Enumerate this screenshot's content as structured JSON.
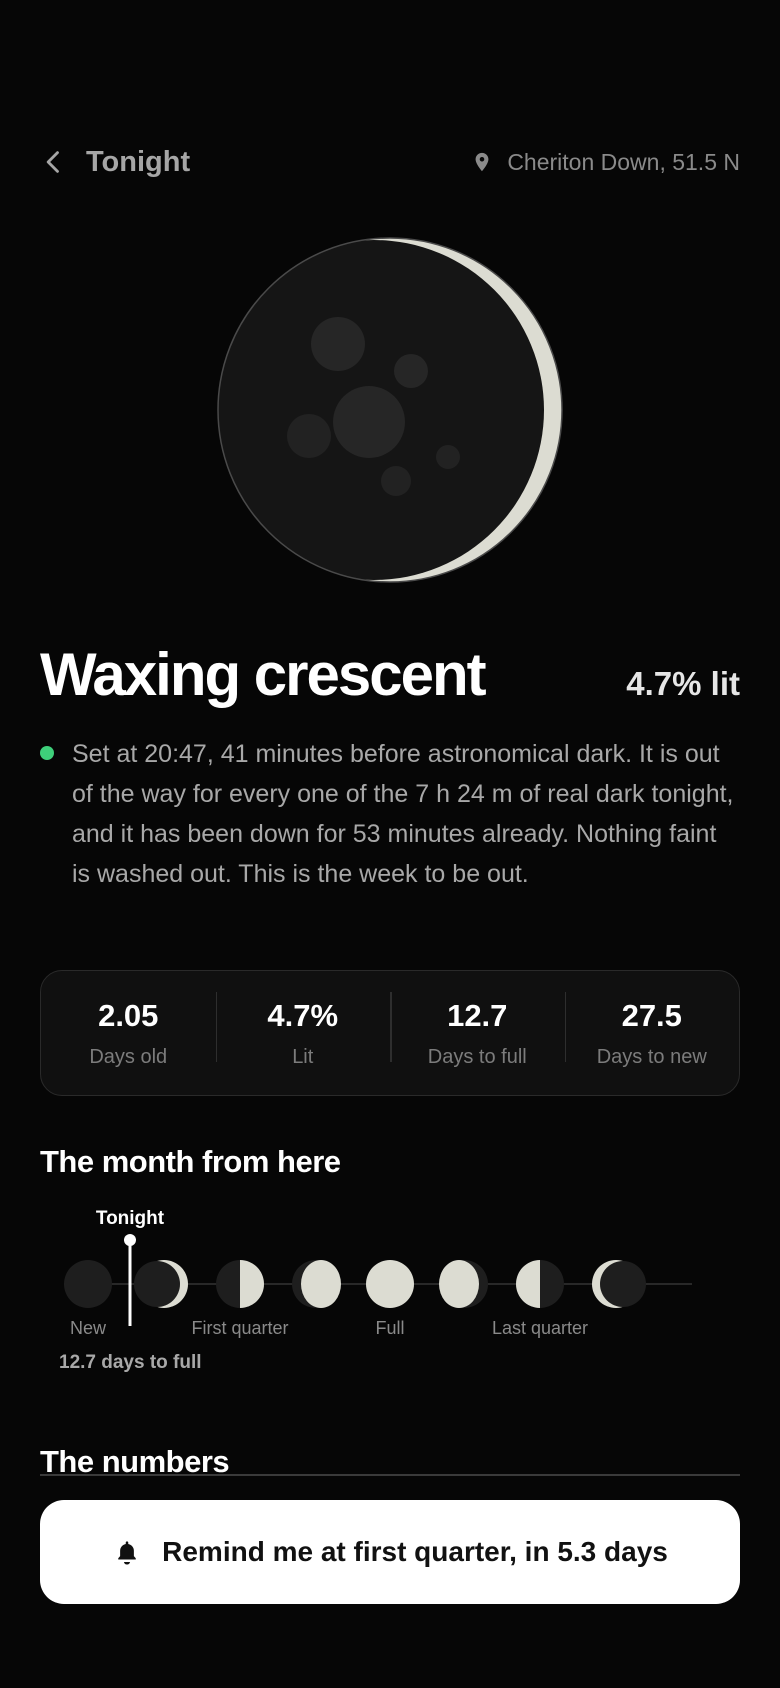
{
  "header": {
    "back_icon": "chevron-left-icon",
    "title": "Tonight",
    "location_icon": "map-pin-icon",
    "location": "Cheriton Down, 51.5 N"
  },
  "phase": {
    "name": "Waxing crescent",
    "lit_label": "4.7% lit",
    "illumination": 0.047,
    "status_color": "#3ecf7a",
    "description": "Set at 20:47, 41 minutes before astronomical dark. It is out of the way for every one of the 7 h 24 m of real dark tonight, and it has been down for 53 minutes already. Nothing faint is washed out. This is the week to be out."
  },
  "stats": [
    {
      "value": "2.05",
      "label": "Days old"
    },
    {
      "value": "4.7%",
      "label": "Lit"
    },
    {
      "value": "12.7",
      "label": "Days to full"
    },
    {
      "value": "27.5",
      "label": "Days to new"
    }
  ],
  "month": {
    "title": "The month from here",
    "marker_label": "Tonight",
    "labels": [
      "New",
      "First quarter",
      "Full",
      "Last quarter"
    ],
    "footnote": "12.7 days to full",
    "phases": [
      "new",
      "waxing-crescent",
      "first-quarter",
      "waxing-gibbous",
      "full",
      "waning-gibbous",
      "last-quarter",
      "waning-crescent"
    ]
  },
  "numbers": {
    "title": "The numbers"
  },
  "cta": {
    "icon": "bell-icon",
    "label": "Remind me at first quarter, in 5.3 days"
  },
  "colors": {
    "background": "#060606",
    "moon_lit": "#dcdcd2",
    "moon_dark": "#151515",
    "accent_green": "#3ecf7a"
  }
}
